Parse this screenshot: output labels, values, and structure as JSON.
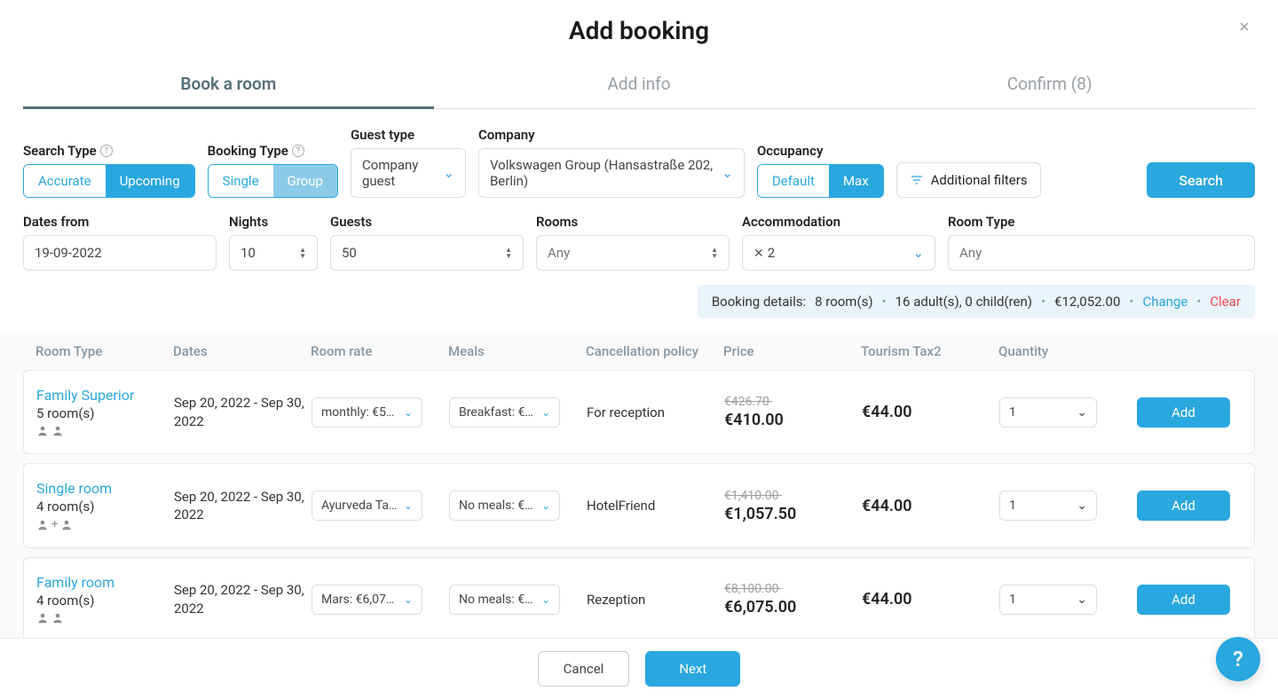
{
  "header": {
    "title": "Add booking"
  },
  "tabs": {
    "book": "Book a room",
    "info": "Add info",
    "confirm": "Confirm (8)"
  },
  "searchType": {
    "label": "Search Type",
    "accurate": "Accurate",
    "upcoming": "Upcoming"
  },
  "bookingType": {
    "label": "Booking Type",
    "single": "Single",
    "group": "Group"
  },
  "guestType": {
    "label": "Guest type",
    "value": "Company guest"
  },
  "company": {
    "label": "Company",
    "value": "Volkswagen Group (Hansastraße 202, Berlin)"
  },
  "occupancy": {
    "label": "Occupancy",
    "default": "Default",
    "max": "Max"
  },
  "filters": {
    "label": "Additional filters"
  },
  "searchBtn": "Search",
  "datesFrom": {
    "label": "Dates from",
    "value": "19-09-2022"
  },
  "nights": {
    "label": "Nights",
    "value": "10"
  },
  "guests": {
    "label": "Guests",
    "value": "50"
  },
  "rooms": {
    "label": "Rooms",
    "placeholder": "Any"
  },
  "accommodation": {
    "label": "Accommodation",
    "value": "2"
  },
  "roomType": {
    "label": "Room Type",
    "placeholder": "Any"
  },
  "summary": {
    "label": "Booking details:",
    "rooms": "8 room(s)",
    "guests": "16 adult(s), 0 child(ren)",
    "total": "€12,052.00",
    "change": "Change",
    "clear": "Clear"
  },
  "columns": {
    "roomType": "Room Type",
    "dates": "Dates",
    "rate": "Room rate",
    "meals": "Meals",
    "policy": "Cancellation poli­cy",
    "price": "Price",
    "tax": "Tourism Tax2",
    "qty": "Quantity"
  },
  "rows": [
    {
      "name": "Family Superior",
      "roomCount": "5 room(s)",
      "peopleDisplay": "2",
      "dates": "Sep 20, 2022 - Sep 30, 2022",
      "rate": "monthly: €5…",
      "meals": "Breakfast: €…",
      "policy": "For reception",
      "oldPrice": "€426.70",
      "price": "€410.00",
      "tax": "€44.00",
      "qty": "1",
      "add": "Add"
    },
    {
      "name": "Single room",
      "roomCount": "4 room(s)",
      "peopleDisplay": "1+1",
      "dates": "Sep 20, 2022 - Sep 30, 2022",
      "rate": "Ayurveda Ta…",
      "meals": "No meals: €…",
      "policy": "HotelFriend",
      "oldPrice": "€1,410.00",
      "price": "€1,057.50",
      "tax": "€44.00",
      "qty": "1",
      "add": "Add"
    },
    {
      "name": "Family room",
      "roomCount": "4 room(s)",
      "peopleDisplay": "2",
      "dates": "Sep 20, 2022 - Sep 30, 2022",
      "rate": "Mars: €6,07…",
      "meals": "No meals: €…",
      "policy": "Rezeption",
      "oldPrice": "€8,100.00",
      "price": "€6,075.00",
      "tax": "€44.00",
      "qty": "1",
      "add": "Add"
    }
  ],
  "footer": {
    "cancel": "Cancel",
    "next": "Next"
  }
}
